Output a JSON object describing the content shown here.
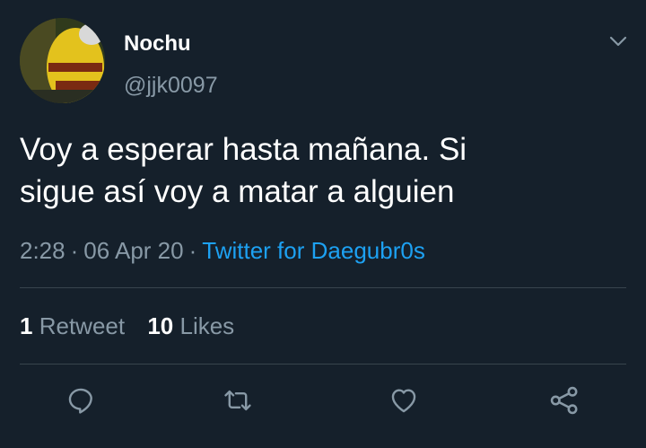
{
  "user": {
    "display_name": "Nochu",
    "handle": "@jjk0097"
  },
  "tweet": {
    "text_line1": "Voy a esperar hasta mañana. Si",
    "text_line2": "sigue así voy a matar a alguien",
    "time": "2:28",
    "separator": "·",
    "date": "06 Apr 20",
    "source": "Twitter for Daegubr0s"
  },
  "stats": {
    "retweets_count": "1",
    "retweets_label": "Retweet",
    "likes_count": "10",
    "likes_label": "Likes"
  },
  "icons": {
    "more": "chevron-down-icon",
    "reply": "reply-icon",
    "retweet": "retweet-icon",
    "like": "heart-icon",
    "share": "share-icon"
  },
  "colors": {
    "background": "#15202b",
    "secondary_text": "#8899a6",
    "accent": "#1da1f2",
    "divider": "#38444d"
  }
}
